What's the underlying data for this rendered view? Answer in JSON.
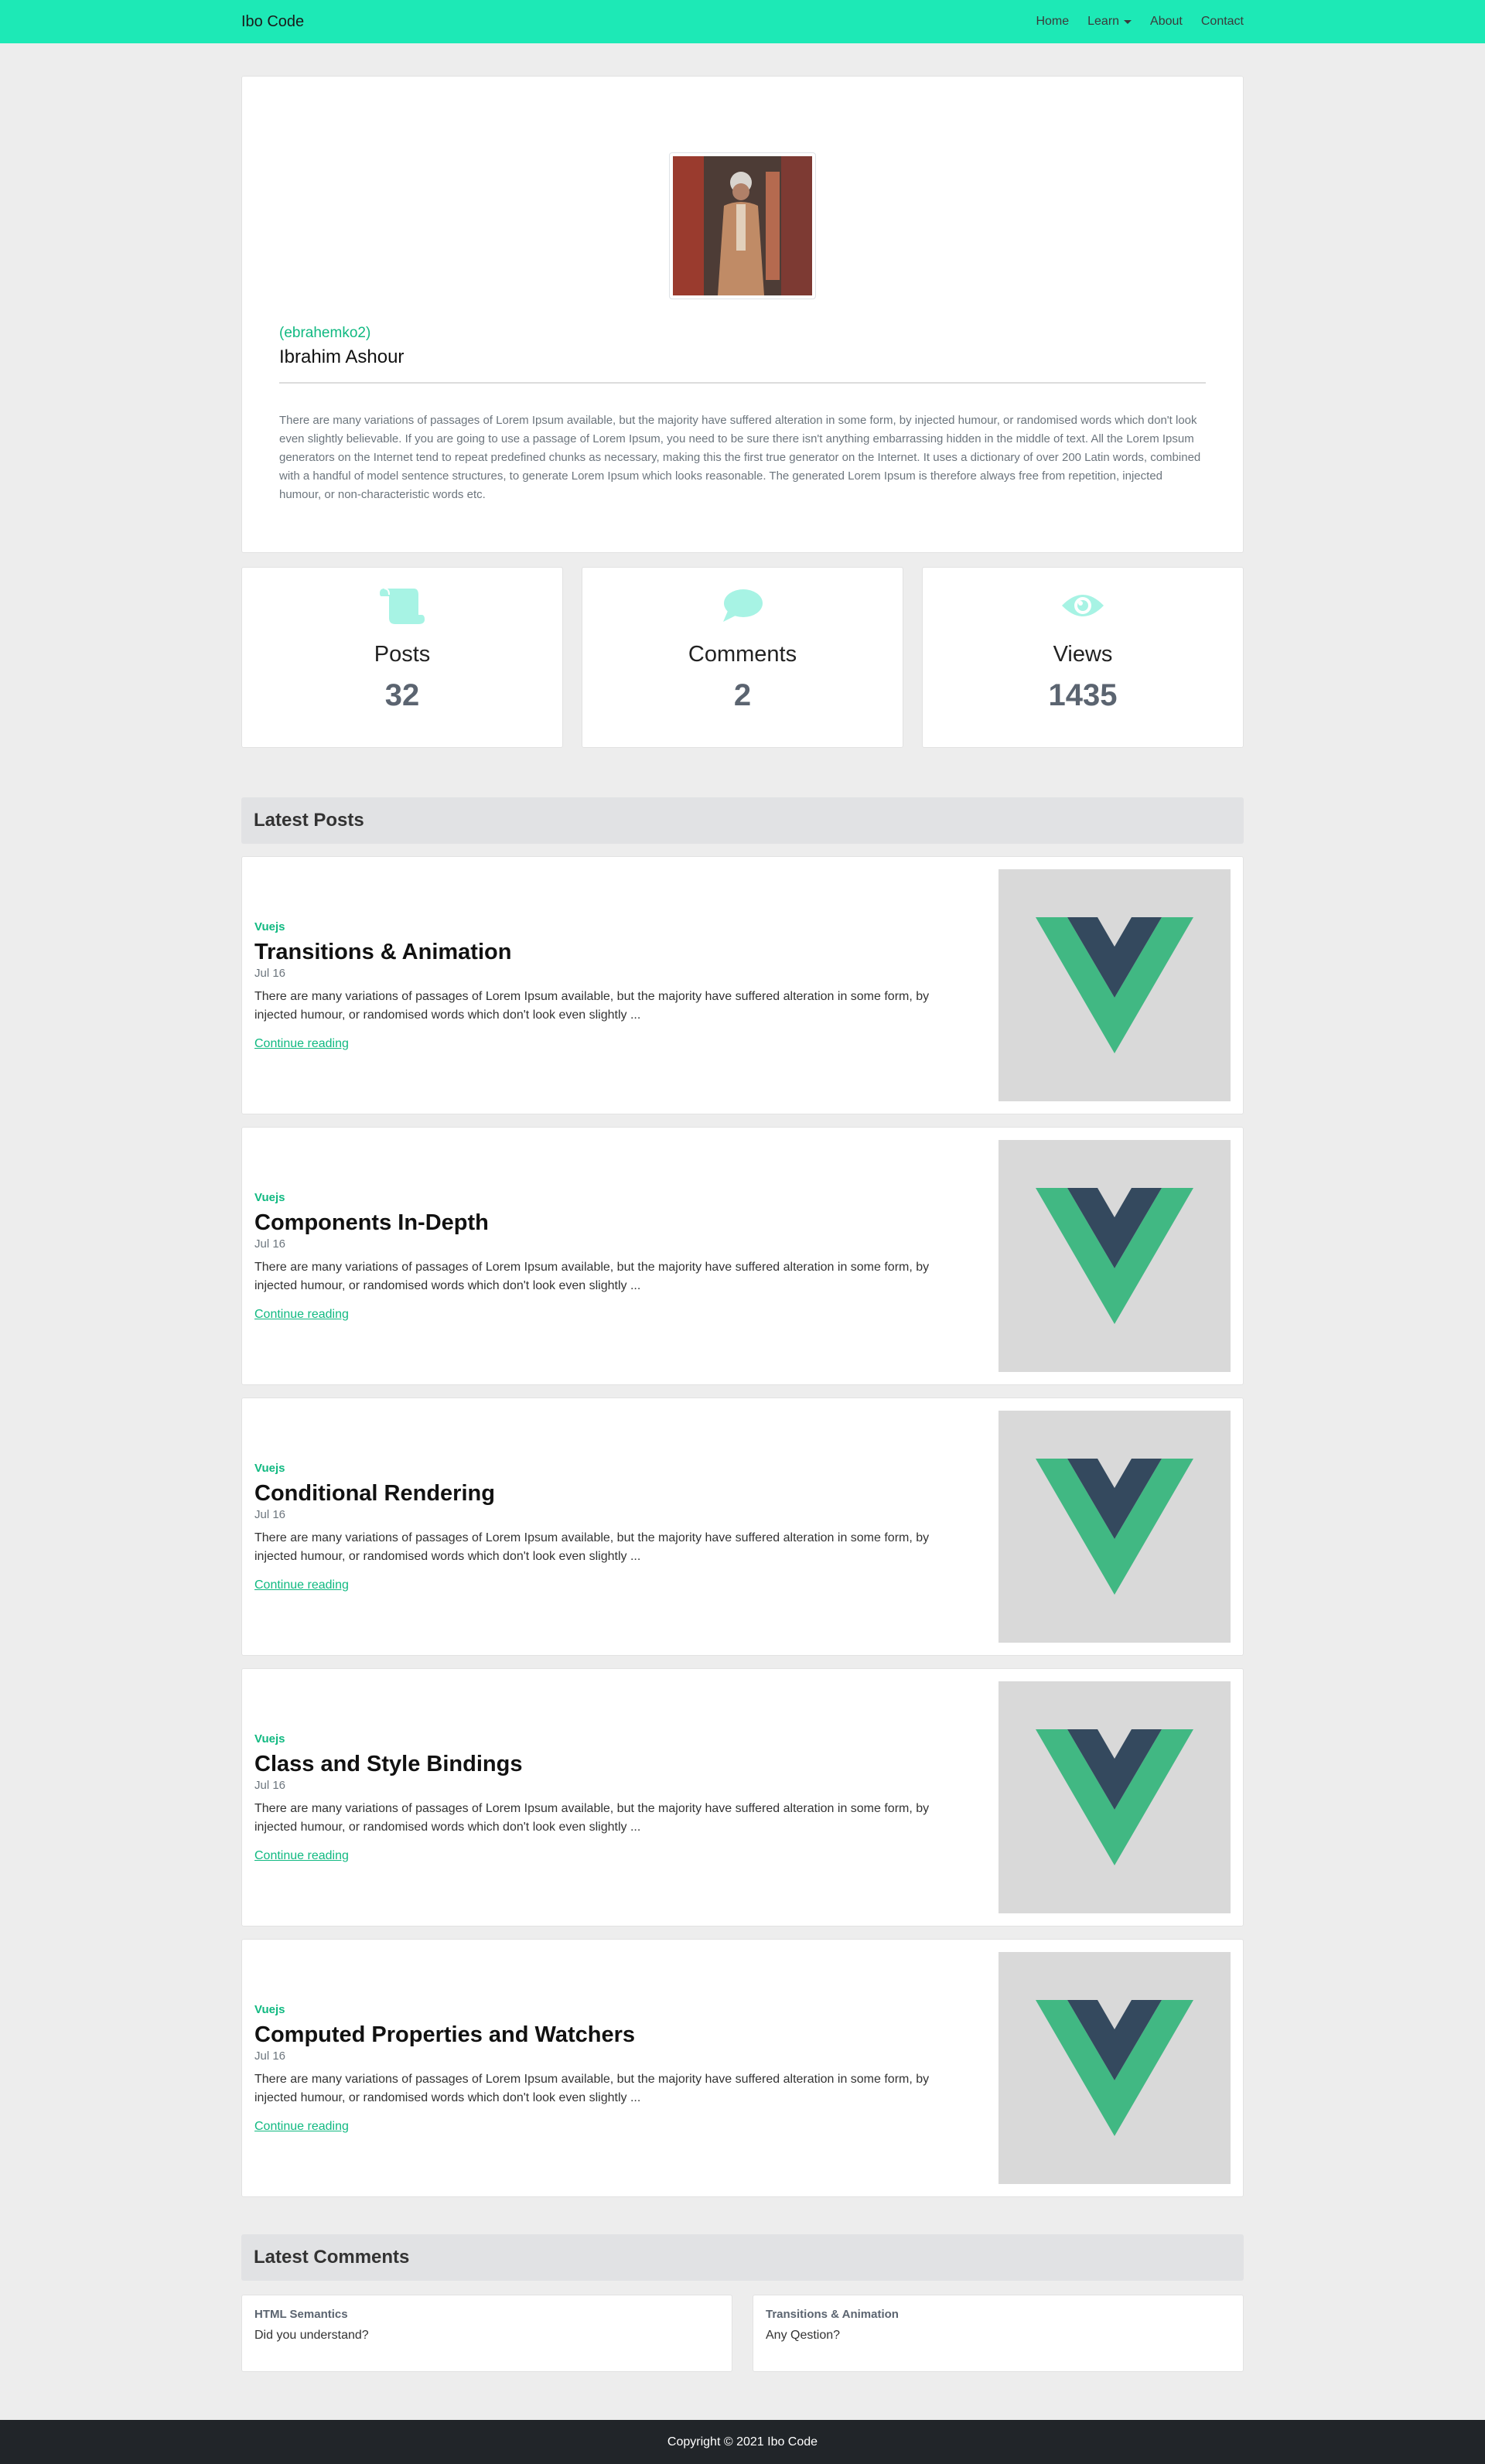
{
  "nav": {
    "brand": "Ibo Code",
    "links": [
      "Home",
      "Learn",
      "About",
      "Contact"
    ]
  },
  "profile": {
    "username": "(ebrahemko2)",
    "name": "Ibrahim Ashour",
    "bio": "There are many variations of passages of Lorem Ipsum available, but the majority have suffered alteration in some form, by injected humour, or randomised words which don't look even slightly believable. If you are going to use a passage of Lorem Ipsum, you need to be sure there isn't anything embarrassing hidden in the middle of text. All the Lorem Ipsum generators on the Internet tend to repeat predefined chunks as necessary, making this the first true generator on the Internet. It uses a dictionary of over 200 Latin words, combined with a handful of model sentence structures, to generate Lorem Ipsum which looks reasonable. The generated Lorem Ipsum is therefore always free from repetition, injected humour, or non-characteristic words etc."
  },
  "stats": [
    {
      "label": "Posts",
      "value": "32",
      "icon": "scroll-icon"
    },
    {
      "label": "Comments",
      "value": "2",
      "icon": "comment-icon"
    },
    {
      "label": "Views",
      "value": "1435",
      "icon": "eye-icon"
    }
  ],
  "colors": {
    "accent": "#1de9b6",
    "link": "#10b981",
    "icon": "#a7f3e4",
    "vue_green": "#41b883",
    "vue_dark": "#34495e"
  },
  "latest_posts": {
    "heading": "Latest Posts",
    "items": [
      {
        "category": "Vuejs",
        "title": "Transitions & Animation",
        "date": "Jul 16",
        "excerpt": "There are many variations of passages of Lorem Ipsum available, but the majority have suffered alteration in some form, by injected humour, or randomised words which don't look even slightly ...",
        "link": "Continue reading"
      },
      {
        "category": "Vuejs",
        "title": "Components In-Depth",
        "date": "Jul 16",
        "excerpt": "There are many variations of passages of Lorem Ipsum available, but the majority have suffered alteration in some form, by injected humour, or randomised words which don't look even slightly ...",
        "link": "Continue reading"
      },
      {
        "category": "Vuejs",
        "title": "Conditional Rendering",
        "date": "Jul 16",
        "excerpt": "There are many variations of passages of Lorem Ipsum available, but the majority have suffered alteration in some form, by injected humour, or randomised words which don't look even slightly ...",
        "link": "Continue reading"
      },
      {
        "category": "Vuejs",
        "title": "Class and Style Bindings",
        "date": "Jul 16",
        "excerpt": "There are many variations of passages of Lorem Ipsum available, but the majority have suffered alteration in some form, by injected humour, or randomised words which don't look even slightly ...",
        "link": "Continue reading"
      },
      {
        "category": "Vuejs",
        "title": "Computed Properties and Watchers",
        "date": "Jul 16",
        "excerpt": "There are many variations of passages of Lorem Ipsum available, but the majority have suffered alteration in some form, by injected humour, or randomised words which don't look even slightly ...",
        "link": "Continue reading"
      }
    ]
  },
  "latest_comments": {
    "heading": "Latest Comments",
    "items": [
      {
        "post": "HTML Semantics",
        "text": "Did you understand?"
      },
      {
        "post": "Transitions & Animation",
        "text": "Any Qestion?"
      }
    ]
  },
  "footer": {
    "text": "Copyright © 2021 Ibo Code"
  }
}
